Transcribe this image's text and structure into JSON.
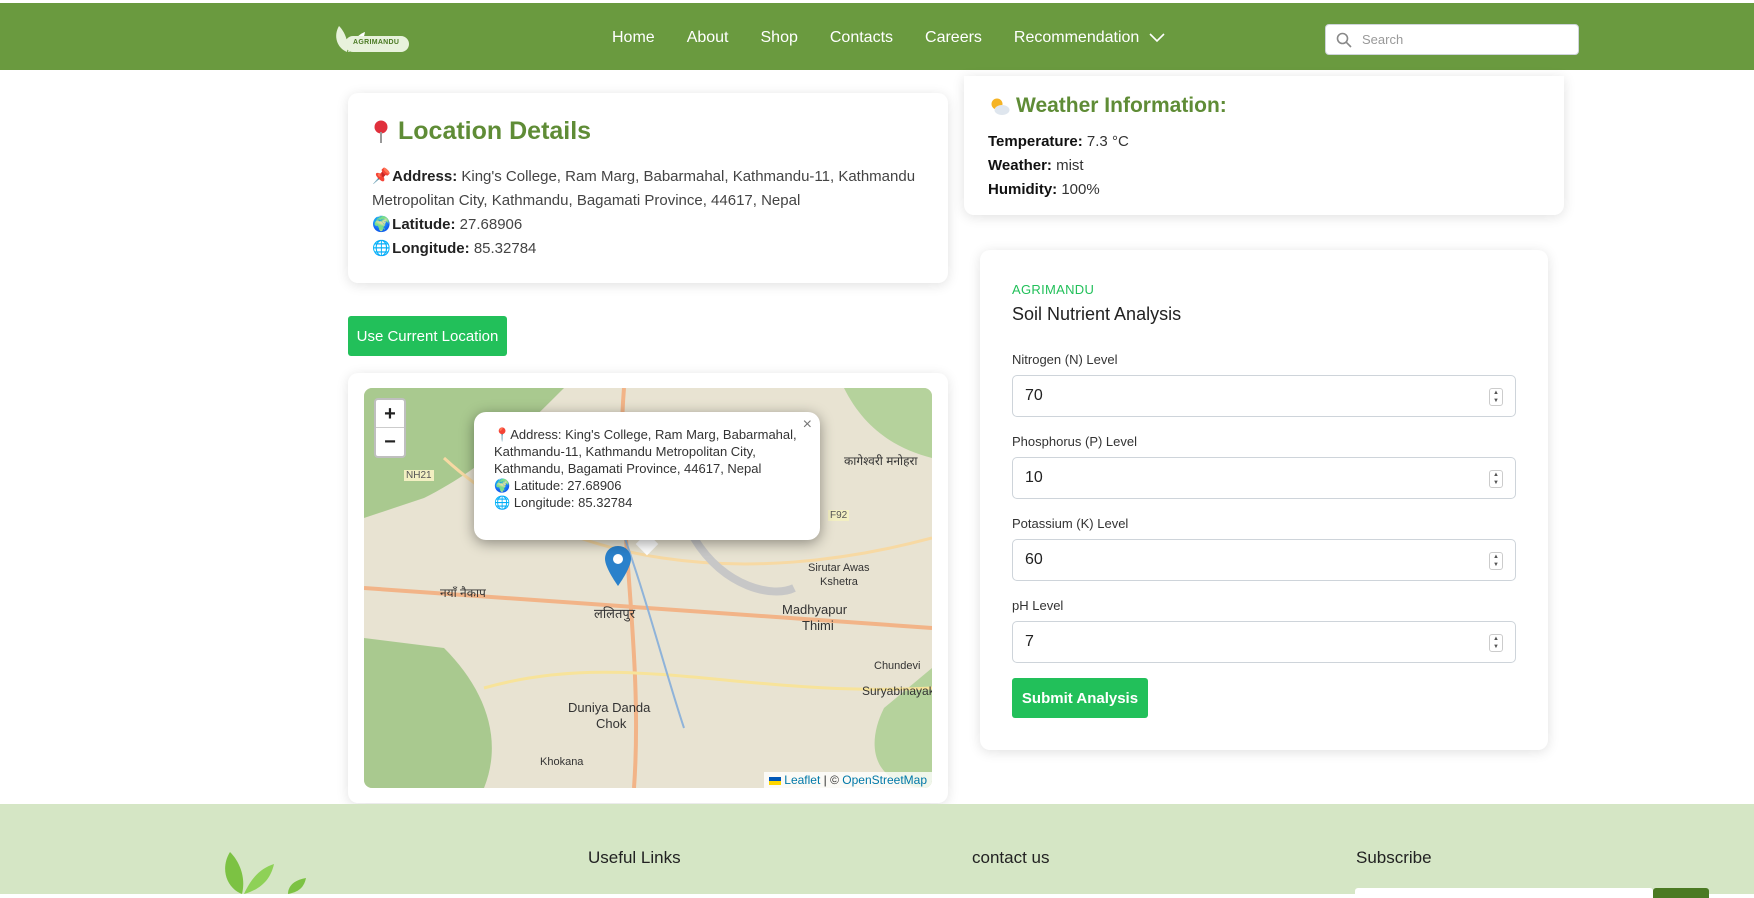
{
  "brand": {
    "logo_text": "AGRIMANDU"
  },
  "nav": {
    "items": [
      "Home",
      "About",
      "Shop",
      "Contacts",
      "Careers"
    ],
    "dropdown_label": "Recommendation"
  },
  "search": {
    "placeholder": "Search"
  },
  "location": {
    "title": "Location Details",
    "address_label": "Address:",
    "address": "King's College, Ram Marg, Babarmahal, Kathmandu-11, Kathmandu Metropolitan City, Kathmandu, Bagamati Province, 44617, Nepal",
    "latitude_label": "Latitude:",
    "latitude": "27.68906",
    "longitude_label": "Longitude:",
    "longitude": "85.32784"
  },
  "weather": {
    "title": "Weather Information:",
    "temperature_label": "Temperature:",
    "temperature": "7.3 °C",
    "weather_label": "Weather:",
    "weather": "mist",
    "humidity_label": "Humidity:",
    "humidity": "100%"
  },
  "use_location_button": "Use Current Location",
  "map": {
    "zoom_in": "+",
    "zoom_out": "−",
    "popup_close": "×",
    "popup_address": "Address: King's College, Ram Marg, Babarmahal, Kathmandu-11, Kathmandu Metropolitan City, Kathmandu, Bagamati Province, 44617, Nepal",
    "popup_latitude": "Latitude: 27.68906",
    "popup_longitude": "Longitude: 85.32784",
    "attrib_leaflet": "Leaflet",
    "attrib_sep": " | © ",
    "attrib_osm": "OpenStreetMap",
    "labels": [
      "NH21",
      "F92",
      "Madhyapur",
      "Thimi",
      "ललितपुर",
      "Duniya Danda",
      "Chok",
      "Khokana",
      "Sirutar Awas",
      "Kshetra",
      "Chundevi",
      "Suryabinayak",
      "नयाँ नैकाप",
      "कागेश्वरी मनोहरा"
    ]
  },
  "soil": {
    "brand": "AGRIMANDU",
    "title": "Soil Nutrient Analysis",
    "fields": [
      {
        "label": "Nitrogen (N) Level",
        "value": "70"
      },
      {
        "label": "Phosphorus (P) Level",
        "value": "10"
      },
      {
        "label": "Potassium (K) Level",
        "value": "60"
      },
      {
        "label": "pH Level",
        "value": "7"
      }
    ],
    "submit": "Submit Analysis"
  },
  "footer": {
    "useful_links": "Useful Links",
    "contact": "contact us",
    "subscribe": "Subscribe"
  },
  "colors": {
    "nav_bg": "#6a9a3f",
    "accent_green": "#22c05a",
    "title_green": "#5f8c36",
    "footer_bg": "#d5e6c5"
  }
}
